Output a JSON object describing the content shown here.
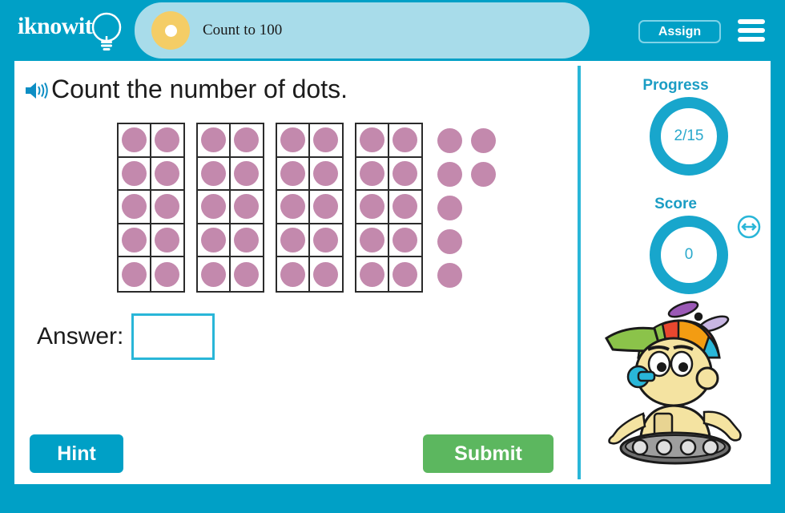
{
  "app": {
    "brand": "iknowit",
    "lesson_title": "Count to 100",
    "frame_color": "#00a0c6",
    "accent_color": "#29b6d8",
    "title_tab_color": "#a8dcea",
    "title_dot_color": "#f4cd66",
    "dot_color": "#c389ad",
    "submit_color": "#5cb75f"
  },
  "header": {
    "assign_label": "Assign",
    "menu_icon": "hamburger-menu-icon",
    "logo_icon": "lightbulb-icon",
    "lesson_icon": "progress-dot-icon"
  },
  "question": {
    "audio_icon": "speaker-icon",
    "prompt": "Count the number of dots."
  },
  "dots": {
    "total": 47,
    "ten_frames": 4,
    "dots_per_frame": 10,
    "frame_rows": 5,
    "frame_cols": 2,
    "loose_dots": 7,
    "loose_layout": [
      {
        "col": 0,
        "row": 0
      },
      {
        "col": 1,
        "row": 0
      },
      {
        "col": 0,
        "row": 1
      },
      {
        "col": 1,
        "row": 1
      },
      {
        "col": 0,
        "row": 2
      },
      {
        "col": 0,
        "row": 3
      },
      {
        "col": 0,
        "row": 4
      }
    ]
  },
  "answer": {
    "label": "Answer:",
    "value": "",
    "placeholder": ""
  },
  "actions": {
    "hint_label": "Hint",
    "submit_label": "Submit"
  },
  "sidebar": {
    "progress_label": "Progress",
    "progress_value": "2/15",
    "score_label": "Score",
    "score_value": "0",
    "mascot_icon": "robot-mascot-icon",
    "resize_icon": "resize-arrows-icon"
  }
}
